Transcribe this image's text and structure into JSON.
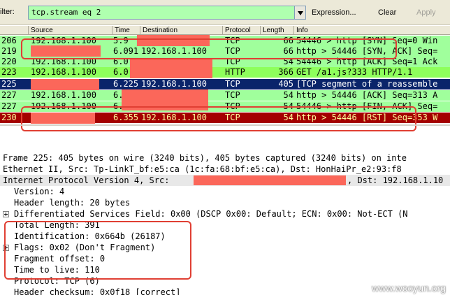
{
  "filter": {
    "label": "ilter:",
    "value": "tcp.stream eq 2",
    "expression_label": "Expression...",
    "clear_label": "Clear",
    "apply_label": "Apply"
  },
  "columns": [
    "Source",
    "Time",
    "Destination",
    "Protocol",
    "Length",
    "Info"
  ],
  "packets": [
    {
      "no": "206",
      "src": "192.168.1.100",
      "time": "5.9",
      "dst": "",
      "proto": "TCP",
      "len": "66",
      "info": "54446 > http [SYN] Seq=0 Win"
    },
    {
      "no": "219",
      "src": "",
      "time": "6.091",
      "dst": "192.168.1.100",
      "proto": "TCP",
      "len": "66",
      "info": "http > 54446 [SYN, ACK] Seq="
    },
    {
      "no": "220",
      "src": "192.168.1.100",
      "time": "6.0",
      "dst": "",
      "proto": "TCP",
      "len": "54",
      "info": "54446 > http [ACK] Seq=1 Ack"
    },
    {
      "no": "223",
      "src": "192.168.1.100",
      "time": "6.0",
      "dst": "",
      "proto": "HTTP",
      "len": "366",
      "info": "GET /a1.js?333 HTTP/1.1"
    },
    {
      "no": "225",
      "src": "",
      "time": "6.225",
      "dst": "192.168.1.100",
      "proto": "TCP",
      "len": "405",
      "info": "[TCP segment of a reassemble"
    },
    {
      "no": "227",
      "src": "192.168.1.100",
      "time": "6.2",
      "dst": "",
      "proto": "TCP",
      "len": "54",
      "info": "http > 54446 [ACK] Seq=313 A"
    },
    {
      "no": "227",
      "src": "192.168.1.100",
      "time": "6.2",
      "dst": "",
      "proto": "TCP",
      "len": "54",
      "info": "54446 > http [FIN, ACK] Seq="
    },
    {
      "no": "230",
      "src": "",
      "time": "6.355",
      "dst": "192.168.1.100",
      "proto": "TCP",
      "len": "54",
      "info": "http > 54446 [RST] Seq=353 W"
    }
  ],
  "details": [
    "Frame 225: 405 bytes on wire (3240 bits), 405 bytes captured (3240 bits) on inte",
    "Ethernet II, Src: Tp-LinkT_bf:e5:ca (1c:fa:68:bf:e5:ca), Dst: HonHaiPr_e2:93:f8",
    "Internet Protocol Version 4, Src:",
    ", Dst: 192.168.1.10",
    "Version: 4",
    "Header length: 20 bytes",
    "Differentiated Services Field: 0x00 (DSCP 0x00: Default; ECN: 0x00: Not-ECT (N",
    "Total Length: 391",
    "Identification: 0x664b (26187)",
    "Flags: 0x02 (Don't Fragment)",
    "Fragment offset: 0",
    "Time to live: 110",
    "Protocol: TCP (6)",
    "Header checksum: 0x0f18 [correct]"
  ],
  "watermark": "www.wooyun.org",
  "colors": {
    "tcp_row": "#a0ff9c",
    "http_row": "#8eff5c",
    "selected_row": "#0a246a",
    "rst_row": "#a40000",
    "redaction": "#fb675a",
    "annotation": "#e03f33"
  }
}
